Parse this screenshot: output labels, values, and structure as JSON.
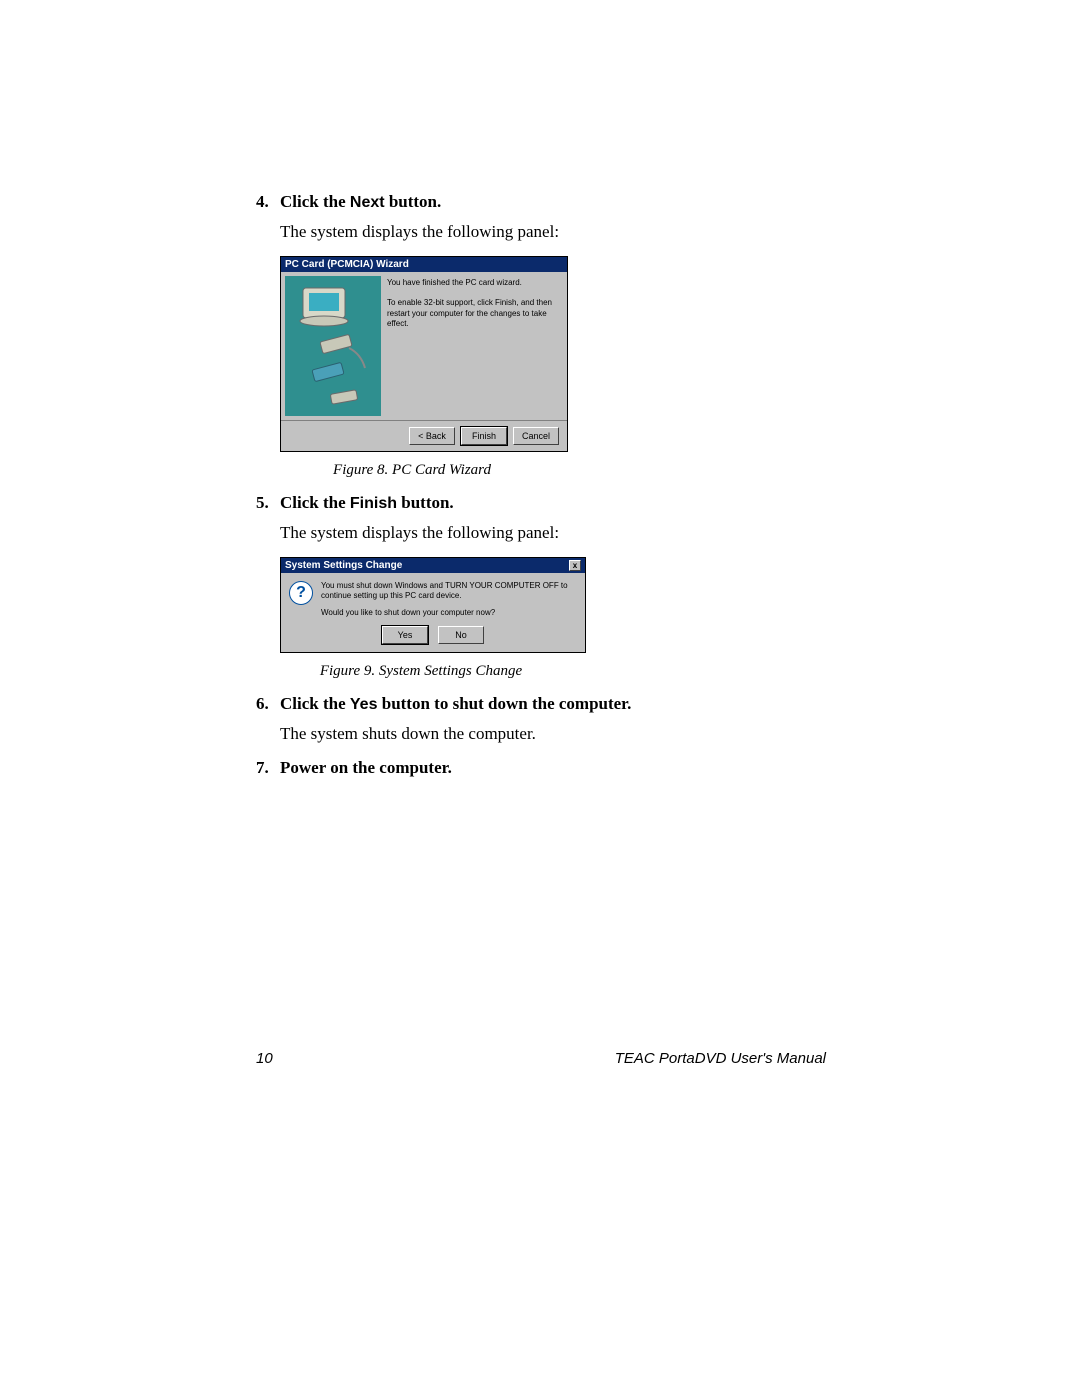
{
  "steps": {
    "s4": {
      "num": "4.",
      "text_before": "Click the ",
      "code": "Next",
      "text_after": " button.",
      "body": "The system displays the following panel:"
    },
    "s5": {
      "num": "5.",
      "text_before": "Click the ",
      "code": "Finish",
      "text_after": " button.",
      "body": "The system displays the following panel:"
    },
    "s6": {
      "num": "6.",
      "text_before": "Click the ",
      "code": "Yes",
      "text_after": " button to shut down the computer.",
      "body": "The system shuts down the computer."
    },
    "s7": {
      "num": "7.",
      "text": "Power on the computer."
    }
  },
  "wizard": {
    "title": "PC Card (PCMCIA) Wizard",
    "p1": "You have finished the PC card wizard.",
    "p2": "To enable 32-bit support, click Finish, and then restart your computer for the changes to take effect.",
    "back": "< Back",
    "finish": "Finish",
    "cancel": "Cancel"
  },
  "caption1": "Figure 8. PC Card Wizard",
  "msgbox": {
    "title": "System Settings Change",
    "close": "x",
    "q": "?",
    "p1": "You must shut down Windows and TURN YOUR COMPUTER OFF to continue setting up this PC card device.",
    "p2": "Would you like to shut down your computer now?",
    "yes": "Yes",
    "no": "No"
  },
  "caption2": "Figure 9. System Settings Change",
  "footer": {
    "page": "10",
    "title": "TEAC PortaDVD User's Manual"
  }
}
